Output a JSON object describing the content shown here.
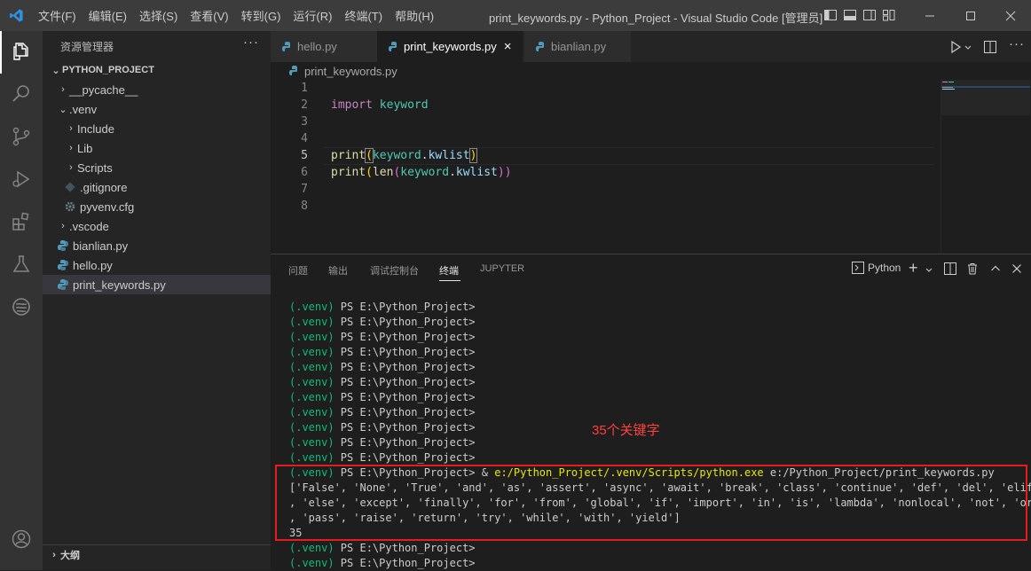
{
  "titlebar": {
    "menu": [
      "文件(F)",
      "编辑(E)",
      "选择(S)",
      "查看(V)",
      "转到(G)",
      "运行(R)",
      "终端(T)",
      "帮助(H)"
    ],
    "title": "print_keywords.py - Python_Project - Visual Studio Code [管理员]"
  },
  "sidebar": {
    "title": "资源管理器",
    "more": "···",
    "project": "PYTHON_PROJECT",
    "items": [
      {
        "label": "__pycache__"
      },
      {
        "label": ".venv"
      },
      {
        "label": "Include"
      },
      {
        "label": "Lib"
      },
      {
        "label": "Scripts"
      },
      {
        "label": ".gitignore"
      },
      {
        "label": "pyvenv.cfg"
      },
      {
        "label": ".vscode"
      },
      {
        "label": "bianlian.py"
      },
      {
        "label": "hello.py"
      },
      {
        "label": "print_keywords.py"
      }
    ],
    "outline": "大纲"
  },
  "tabs": [
    {
      "label": "hello.py"
    },
    {
      "label": "print_keywords.py",
      "close": "×"
    },
    {
      "label": "bianlian.py"
    }
  ],
  "breadcrumb": "print_keywords.py",
  "editor": {
    "line_numbers": [
      "1",
      "2",
      "3",
      "4",
      "5",
      "6",
      "7",
      "8"
    ],
    "kw_import": "import",
    "kw_module": "keyword",
    "line5": {
      "fn": "print",
      "open": "(",
      "obj": "keyword",
      "dot": ".",
      "attr": "kwlist",
      "close": ")"
    },
    "line6": {
      "fn": "print",
      "open1": "(",
      "fn2": "len",
      "open2": "(",
      "obj": "keyword",
      "dot": ".",
      "attr": "kwlist",
      "close": "))"
    }
  },
  "panel": {
    "tabs": [
      "问题",
      "输出",
      "调试控制台",
      "终端",
      "JUPYTER"
    ],
    "shell_label": "Python",
    "add": "+"
  },
  "terminal": {
    "venv": "(.venv)",
    "prompt": " PS E:\\Python_Project>",
    "cmd_amp": " & ",
    "cmd_exe": "e:/Python_Project/.venv/Scripts/python.exe",
    "cmd_arg": " e:/Python_Project/print_keywords.py",
    "output": [
      "['False', 'None', 'True', 'and', 'as', 'assert', 'async', 'await', 'break', 'class', 'continue', 'def', 'del', 'elif'",
      ", 'else', 'except', 'finally', 'for', 'from', 'global', 'if', 'import', 'in', 'is', 'lambda', 'nonlocal', 'not', 'or'",
      ", 'pass', 'raise', 'return', 'try', 'while', 'with', 'yield']",
      "35"
    ],
    "annotation": "35个关键字"
  },
  "colors": {
    "activity_bg": "#333333",
    "sidebar_bg": "#252526",
    "editor_bg": "#1e1e1e",
    "terminal_green": "#0dbc79",
    "terminal_yellow": "#e5e510",
    "annotation_red": "#e51d1d"
  }
}
